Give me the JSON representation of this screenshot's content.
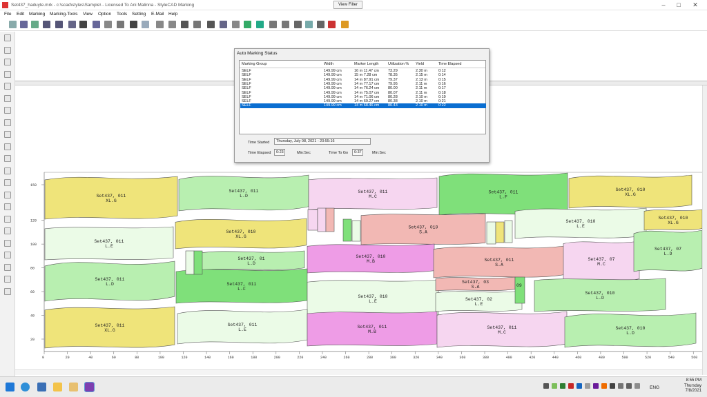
{
  "window": {
    "title": "Set437_haduyte.mrk - c:\\scad\\styles\\Sample\\ - Licensed To Ani Malinna - StyleCAD Marking",
    "view_filter": "View Filter"
  },
  "menu": [
    "File",
    "Edit",
    "Marking",
    "Marking-Tools",
    "View",
    "Option",
    "Tools",
    "Setting",
    "E-Mail",
    "Help"
  ],
  "dialog": {
    "title": "Auto Marking Status",
    "headers": [
      "Marking Group",
      "Width",
      "Marker Length",
      "Utilization %",
      "Yield",
      "Time Elapsed"
    ],
    "rows": [
      [
        "SELF",
        "149.99 cm",
        "16 m 11.47 cm",
        "73.29",
        "2.30 m",
        "0:12"
      ],
      [
        "SELF",
        "149.99 cm",
        "15 m 7.28 cm",
        "78.35",
        "2.15 m",
        "0:14"
      ],
      [
        "SELF",
        "149.99 cm",
        "14 m 87.91 cm",
        "79.37",
        "2.13 m",
        "0:15"
      ],
      [
        "SELF",
        "149.99 cm",
        "14 m 77.17 cm",
        "79.95",
        "2.11 m",
        "0:16"
      ],
      [
        "SELF",
        "149.99 cm",
        "14 m 76.24 cm",
        "80.00",
        "2.11 m",
        "0:17"
      ],
      [
        "SELF",
        "149.99 cm",
        "14 m 75.07 cm",
        "80.07",
        "2.11 m",
        "0:18"
      ],
      [
        "SELF",
        "149.99 cm",
        "14 m 71.06 cm",
        "80.28",
        "2.10 m",
        "0:19"
      ],
      [
        "SELF",
        "149.99 cm",
        "14 m 69.27 cm",
        "80.38",
        "2.10 m",
        "0:21"
      ],
      [
        "SELF",
        "149.99 cm",
        "14 m 68.46 cm",
        "80.43",
        "2.10 m",
        "0:22"
      ]
    ],
    "selected_row": 8,
    "time_started_label": "Time Started",
    "time_started_value": "Thursday, July 08, 2021 - 20:55:16",
    "time_elapsed_label": "Time Elapsed",
    "time_elapsed_value": "0:23",
    "min_sec_1": "Min:Sec",
    "time_to_go_label": "Time To Go",
    "time_to_go_value": "0:37",
    "min_sec_2": "Min:Sec"
  },
  "canvas": {
    "y_ticks": [
      "150",
      "120",
      "100",
      "80",
      "60",
      "40",
      "20"
    ],
    "x_ticks": [
      "0",
      "20",
      "40",
      "60",
      "80",
      "100",
      "120",
      "140",
      "160",
      "180",
      "200",
      "220",
      "240",
      "260",
      "280",
      "300",
      "320",
      "340",
      "360",
      "380",
      "400",
      "420",
      "440",
      "460",
      "480",
      "500",
      "520",
      "540",
      "560"
    ],
    "pieces": [
      {
        "name": "Set437, 011",
        "size": "XL.G",
        "color": "#efe47a"
      },
      {
        "name": "Set437, 011",
        "size": "L.D",
        "color": "#b8efb0"
      },
      {
        "name": "Set437, 011",
        "size": "M.C",
        "color": "#f6d6f0"
      },
      {
        "name": "Set437, 011",
        "size": "L.F",
        "color": "#7fe07a"
      },
      {
        "name": "Set437, 010",
        "size": "XL.G",
        "color": "#efe47a"
      },
      {
        "name": "Set437, 010",
        "size": "XL.G",
        "color": "#efe47a"
      },
      {
        "name": "Set437, 010",
        "size": "S.A",
        "color": "#f2b8b4"
      },
      {
        "name": "Set437, 010",
        "size": "L.E",
        "color": "#ebfbe7"
      },
      {
        "name": "Set437, 010",
        "size": "XL.G",
        "color": "#efe47a"
      },
      {
        "name": "Set437, 011",
        "size": "L.E",
        "color": "#ebfbe7"
      },
      {
        "name": "Set437, 01",
        "size": "L.D",
        "color": "#b8efb0"
      },
      {
        "name": "Set437, 010",
        "size": "M.B",
        "color": "#ee9ce6"
      },
      {
        "name": "Set437, 011",
        "size": "S.A",
        "color": "#f2b8b4"
      },
      {
        "name": "Set437, 07",
        "size": "M.C",
        "color": "#f6d6f0"
      },
      {
        "name": "Set437, 07",
        "size": "L.D",
        "color": "#b8efb0"
      },
      {
        "name": "Set437, 011",
        "size": "L.D",
        "color": "#b8efb0"
      },
      {
        "name": "Set437, 011",
        "size": "L.F",
        "color": "#7fe07a"
      },
      {
        "name": "Set437, 010",
        "size": "L.E",
        "color": "#ebfbe7"
      },
      {
        "name": "Set437, 03",
        "size": "S.A",
        "color": "#f2b8b4"
      },
      {
        "name": "Set437, 02",
        "size": "L.E",
        "color": "#ebfbe7"
      },
      {
        "name": "Set437, 010",
        "size": "L.D",
        "color": "#b8efb0"
      },
      {
        "name": "Set437, 011",
        "size": "XL.G",
        "color": "#efe47a"
      },
      {
        "name": "Set437, 011",
        "size": "L.E",
        "color": "#ebfbe7"
      },
      {
        "name": "Set437, 011",
        "size": "M.B",
        "color": "#ee9ce6"
      },
      {
        "name": "Set437, 011",
        "size": "M.C",
        "color": "#f6d6f0"
      },
      {
        "name": "Set437, 010",
        "size": "L.D",
        "color": "#b8efb0"
      }
    ],
    "extra_labels": [
      "09"
    ]
  },
  "taskbar": {
    "lang": "ENG",
    "time": "8:55 PM",
    "day": "Thursday",
    "date": "7/8/2021"
  }
}
